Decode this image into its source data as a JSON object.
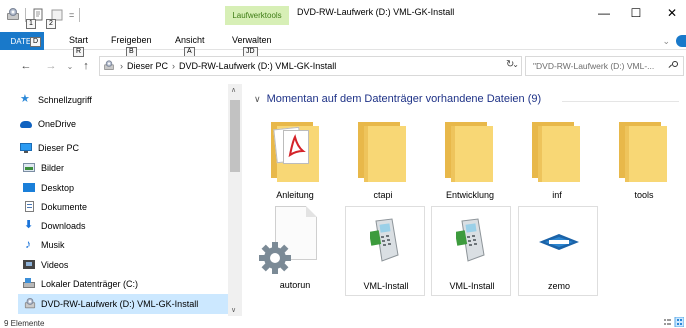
{
  "window": {
    "title": "DVD-RW-Laufwerk (D:) VML-GK-Install",
    "context_tab": "Laufwerktools",
    "quick_access_dropdown": "=",
    "minimize": "—",
    "maximize": "☐",
    "close": "✕"
  },
  "keytips": {
    "qa1": "1",
    "qa2": "2",
    "file": "D",
    "start": "R",
    "share": "B",
    "view": "A",
    "manage": "JD"
  },
  "ribbon": {
    "file": "DATEI",
    "tabs": [
      "Start",
      "Freigeben",
      "Ansicht",
      "Verwalten"
    ]
  },
  "navigation": {
    "back": "←",
    "forward": "→",
    "up": "↑",
    "breadcrumb": [
      "Dieser PC",
      "DVD-RW-Laufwerk (D:) VML-GK-Install"
    ],
    "separator": "›",
    "dropdown": "⌄",
    "refresh": "↻",
    "search_placeholder": "\"DVD-RW-Laufwerk (D:) VML-..."
  },
  "sidebar": {
    "items": [
      {
        "label": "Schnellzugriff",
        "icon": "star-icon"
      },
      {
        "label": "OneDrive",
        "icon": "cloud-icon"
      },
      {
        "label": "Dieser PC",
        "icon": "computer-icon"
      },
      {
        "label": "Bilder",
        "icon": "pictures-icon"
      },
      {
        "label": "Desktop",
        "icon": "desktop-icon"
      },
      {
        "label": "Dokumente",
        "icon": "documents-icon"
      },
      {
        "label": "Downloads",
        "icon": "downloads-icon"
      },
      {
        "label": "Musik",
        "icon": "music-icon"
      },
      {
        "label": "Videos",
        "icon": "videos-icon"
      },
      {
        "label": "Lokaler Datenträger (C:)",
        "icon": "local-disk-icon"
      },
      {
        "label": "DVD-RW-Laufwerk (D:) VML-GK-Install",
        "icon": "dvd-drive-icon",
        "selected": true
      }
    ]
  },
  "content": {
    "group_title": "Momentan auf dem Datenträger vorhandene Dateien (9)",
    "files": [
      {
        "name": "Anleitung",
        "type": "pdf-folder"
      },
      {
        "name": "ctapi",
        "type": "folder"
      },
      {
        "name": "Entwicklung",
        "type": "folder"
      },
      {
        "name": "inf",
        "type": "folder"
      },
      {
        "name": "tools",
        "type": "folder"
      },
      {
        "name": "autorun",
        "type": "settings-file"
      },
      {
        "name": "VML-Install",
        "type": "application"
      },
      {
        "name": "VML-Install",
        "type": "application"
      },
      {
        "name": "zemo",
        "type": "zemo-logo"
      }
    ]
  },
  "status": {
    "item_count": "9 Elemente"
  },
  "colors": {
    "accent": "#1979ca",
    "context_tab_bg": "#d7efb6",
    "context_tab_text": "#3f7d16",
    "selection": "#cce8ff",
    "folder": "#f8d775",
    "group_title": "#1e3287"
  }
}
